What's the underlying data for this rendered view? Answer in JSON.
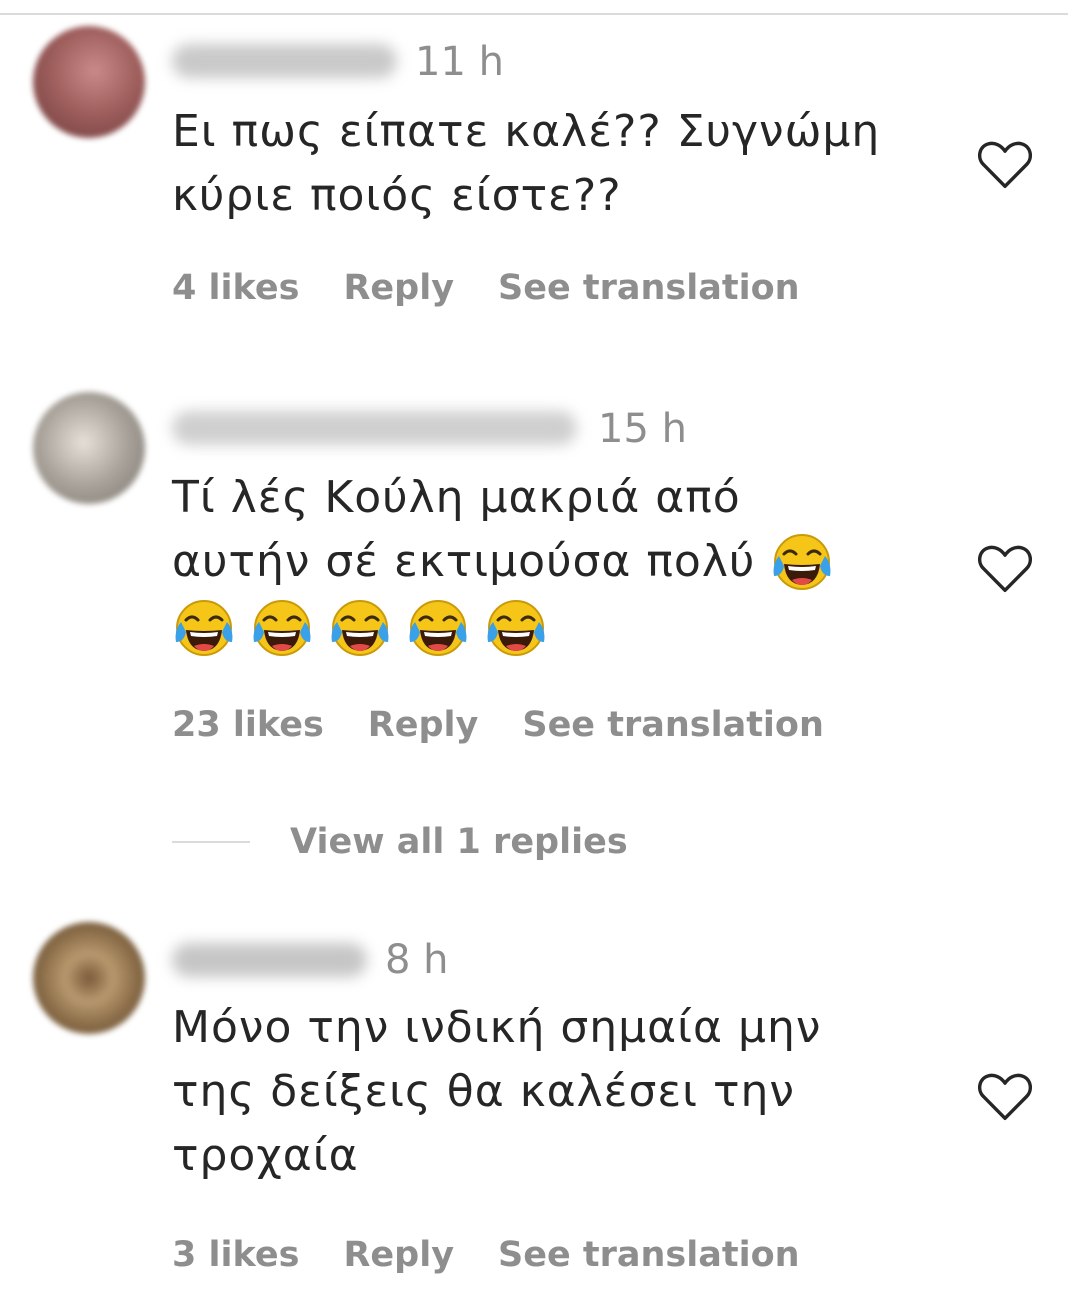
{
  "comments": [
    {
      "time": "11 h",
      "text_lines": [
        "Ει πως είπατε καλέ?? Συγνώμη",
        "κύριε ποιός είστε??"
      ],
      "likes": "4 likes",
      "reply_label": "Reply",
      "translate_label": "See translation",
      "avatar_colors": [
        "#c98a8a",
        "#6b3a3a"
      ]
    },
    {
      "time": "15 h",
      "text_lines": [
        "Τί λές Κούλη μακριά από",
        "αυτήν σέ εκτιμούσα πολύ"
      ],
      "emoji_count_inline": 1,
      "emoji_count_next_line": 5,
      "emoji_name": "face-with-tears-of-joy",
      "likes": "23 likes",
      "reply_label": "Reply",
      "translate_label": "See translation",
      "avatar_colors": [
        "#d8d2c8",
        "#7a746c"
      ]
    },
    {
      "time": "8 h",
      "text_lines": [
        "Μόνο την ινδική σημαία μην",
        "της δείξεις θα καλέσει την",
        "τροχαία"
      ],
      "likes": "3 likes",
      "reply_label": "Reply",
      "translate_label": "See translation",
      "avatar_colors": [
        "#a88b63",
        "#5a4630"
      ]
    }
  ],
  "view_replies": "View all 1 replies",
  "icons": {
    "like": "heart-outline-icon",
    "emoji": "face-with-tears-of-joy"
  },
  "colors": {
    "text": "#262626",
    "secondary": "#8e8e8e",
    "divider": "#dbdbdb",
    "emoji_face": "#f5c518",
    "emoji_tears": "#3aa0e8"
  }
}
